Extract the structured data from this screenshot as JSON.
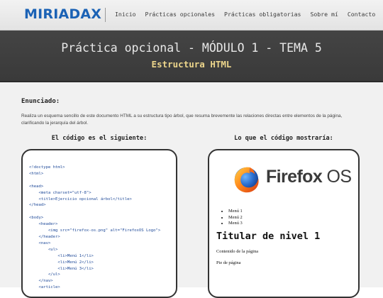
{
  "header": {
    "logo": "MIRIADAX",
    "nav": [
      "Inicio",
      "Prácticas opcionales",
      "Prácticas obligatorias",
      "Sobre mí",
      "Contacto"
    ]
  },
  "banner": {
    "title": "Práctica opcional - MÓDULO 1 - TEMA 5",
    "subtitle": "Estructura HTML"
  },
  "enunciado": {
    "heading": "Enunciado:",
    "text": "Realiza un esquema sencillo de este documento HTML a su estructura tipo árbol, que resuma brevemente las relaciones directas entre elementos de la página, clarificando la jerarquía del árbol."
  },
  "code_panel": {
    "heading": "El código es el siguiente:",
    "lines": [
      "<!doctype html>",
      "<html>",
      "",
      "<head>",
      "    <meta charset=\"utf-8\">",
      "    <title>Ejercicio opcional árbol</title>",
      "</head>",
      "",
      "<body>",
      "    <header>",
      "        <img src=\"firefox-os.png\" alt=\"FirefoxOS Logo\">",
      "    </header>",
      "    <nav>",
      "        <ul>",
      "            <li>Menú 1</li>",
      "            <li>Menú 2</li>",
      "            <li>Menú 3</li>",
      "        </ul>",
      "    </nav>",
      "    <article>"
    ]
  },
  "render_panel": {
    "heading": "Lo que el código mostraría:",
    "logo_text_bold": "Firefox",
    "logo_text_light": " OS",
    "menu": [
      "Menú 1",
      "Menú 2",
      "Menú 3"
    ],
    "h1": "Titular de nivel 1",
    "content": "Contenido de la página",
    "footer": "Pie de página"
  },
  "colors": {
    "logo": "#1b62b5",
    "banner_bg": "#3f3f3f",
    "banner_subtitle": "#ecd58b",
    "code_text": "#1f4a99"
  }
}
